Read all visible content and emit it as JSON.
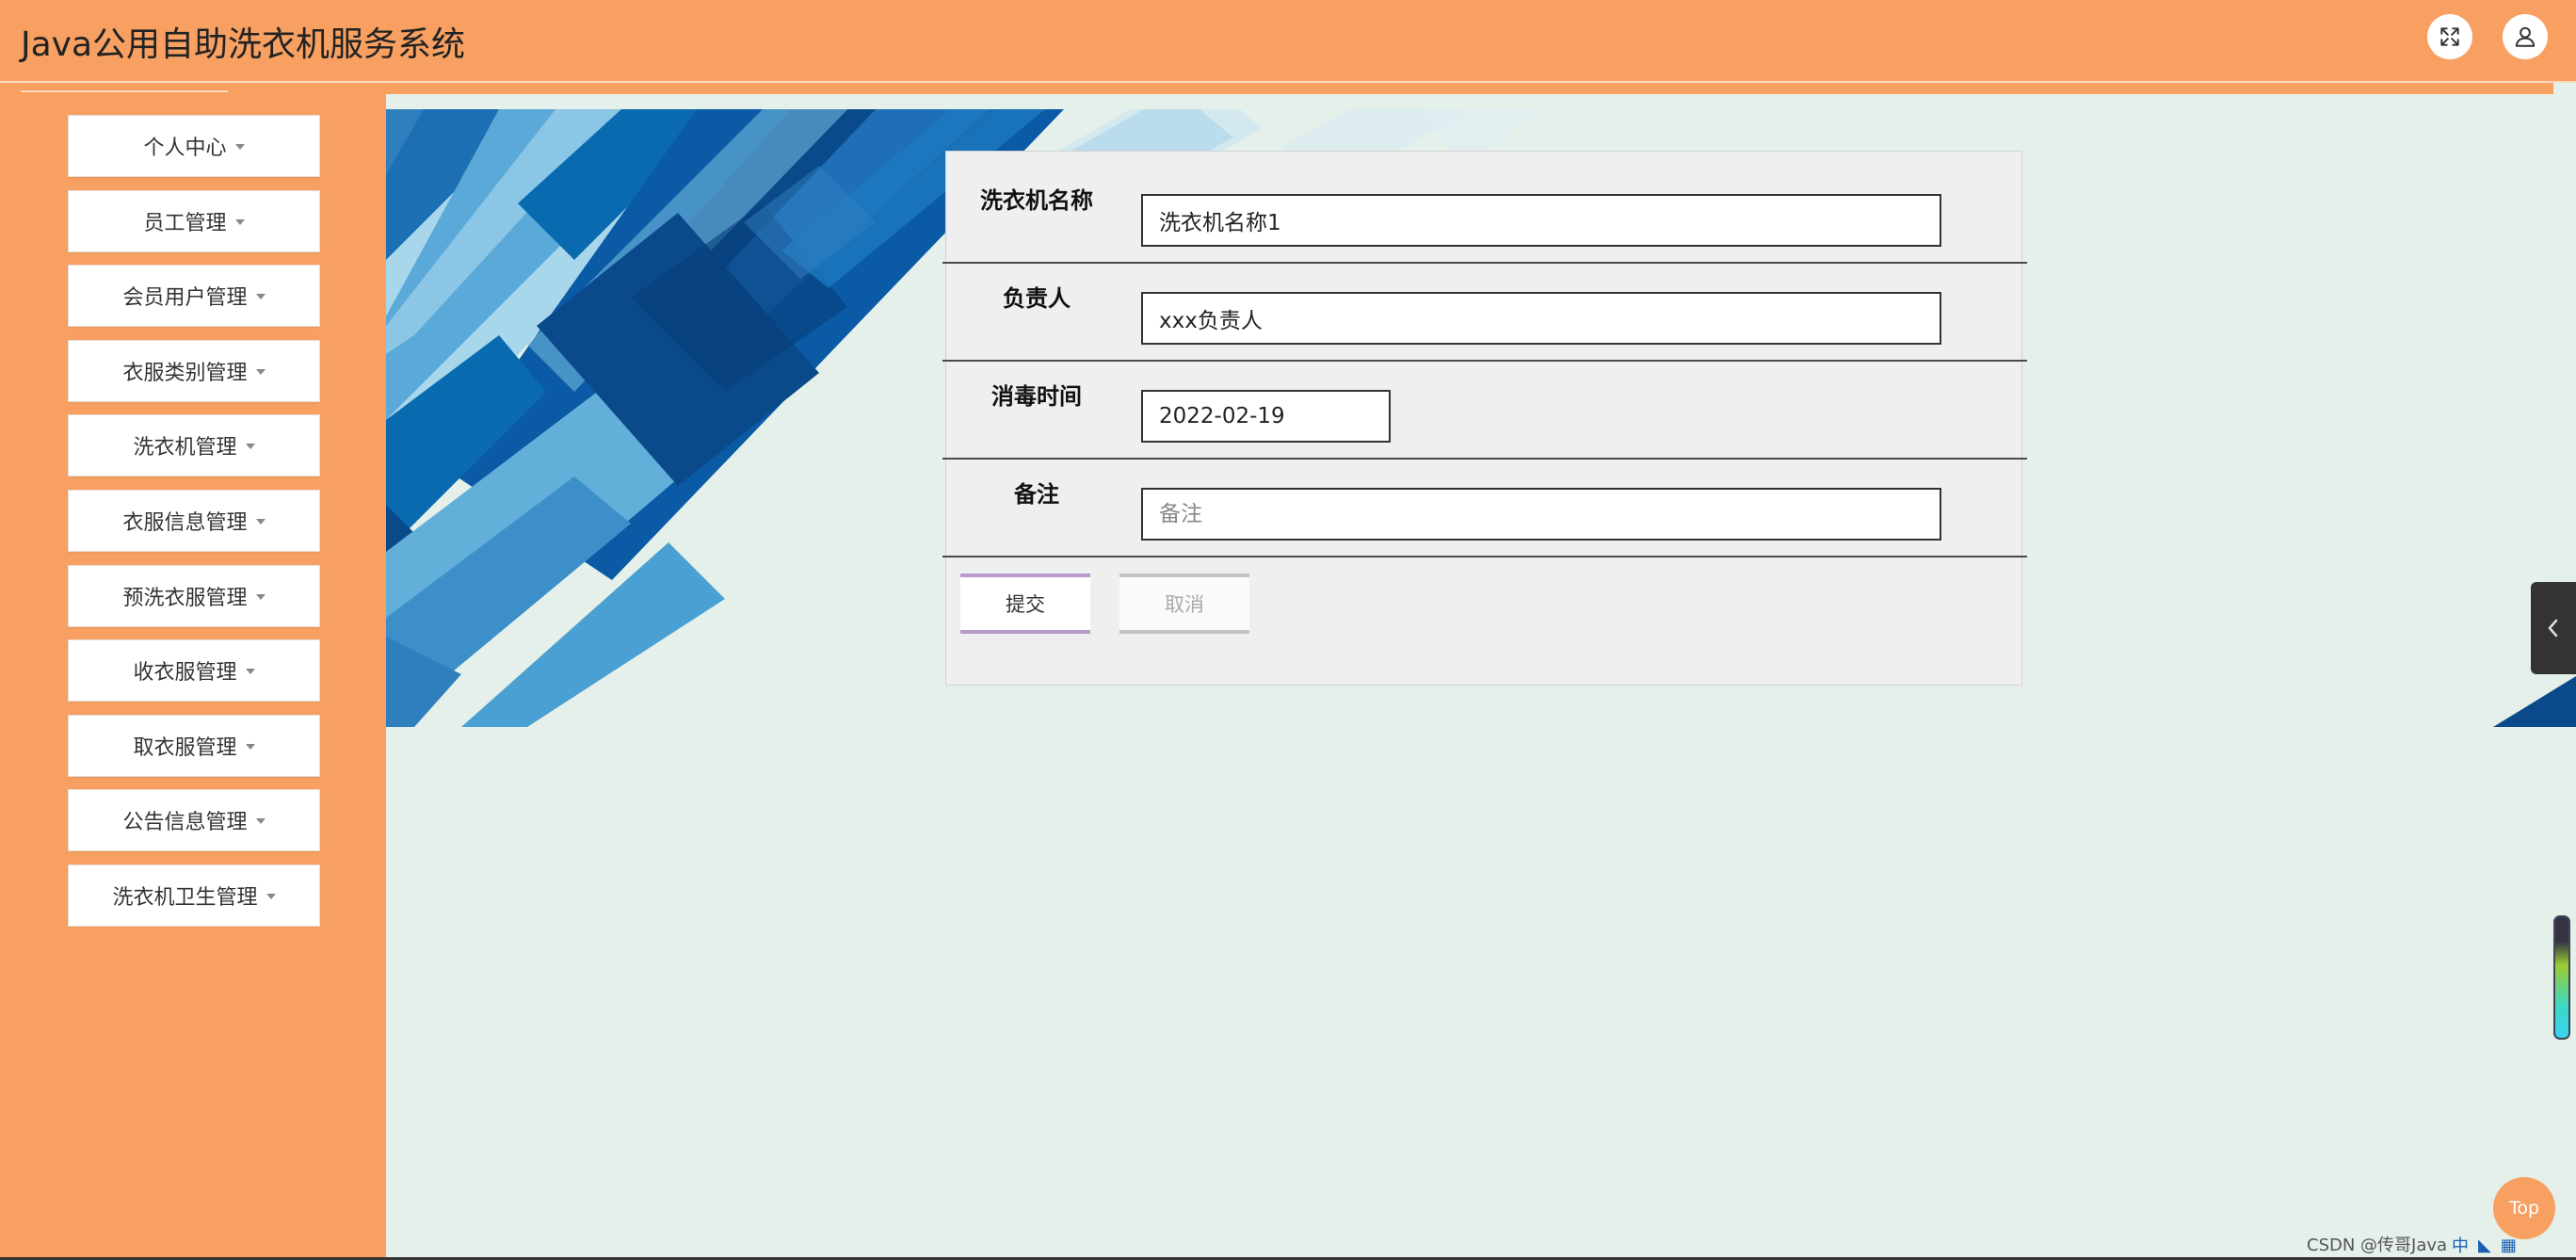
{
  "header": {
    "title": "Java公用自助洗衣机服务系统",
    "fullscreen_icon": "fullscreen-expand-icon",
    "user_icon": "user-icon"
  },
  "sidebar": {
    "items": [
      {
        "label": "个人中心"
      },
      {
        "label": "员工管理"
      },
      {
        "label": "会员用户管理"
      },
      {
        "label": "衣服类别管理"
      },
      {
        "label": "洗衣机管理"
      },
      {
        "label": "衣服信息管理"
      },
      {
        "label": "预洗衣服管理"
      },
      {
        "label": "收衣服管理"
      },
      {
        "label": "取衣服管理"
      },
      {
        "label": "公告信息管理"
      },
      {
        "label": "洗衣机卫生管理"
      }
    ]
  },
  "form": {
    "fields": [
      {
        "label": "洗衣机名称",
        "value": "洗衣机名称1",
        "placeholder": "洗衣机名称"
      },
      {
        "label": "负责人",
        "value": "xxx负责人",
        "placeholder": "负责人"
      },
      {
        "label": "消毒时间",
        "value": "2022-02-19",
        "placeholder": "消毒时间"
      },
      {
        "label": "备注",
        "value": "",
        "placeholder": "备注"
      }
    ],
    "submit_label": "提交",
    "cancel_label": "取消"
  },
  "widgets": {
    "top_label": "Top",
    "watermark": "CSDN @传哥Java",
    "tray_ime": "中",
    "collapse_icon": "chevron-left-icon"
  },
  "colors": {
    "primary": "#f7a062",
    "content_bg": "#e5f0ea",
    "form_bg": "#efefef",
    "submit_accent": "#b89acd",
    "banner_dark": "#0a4a8a",
    "banner_light": "#a8d6ea"
  }
}
